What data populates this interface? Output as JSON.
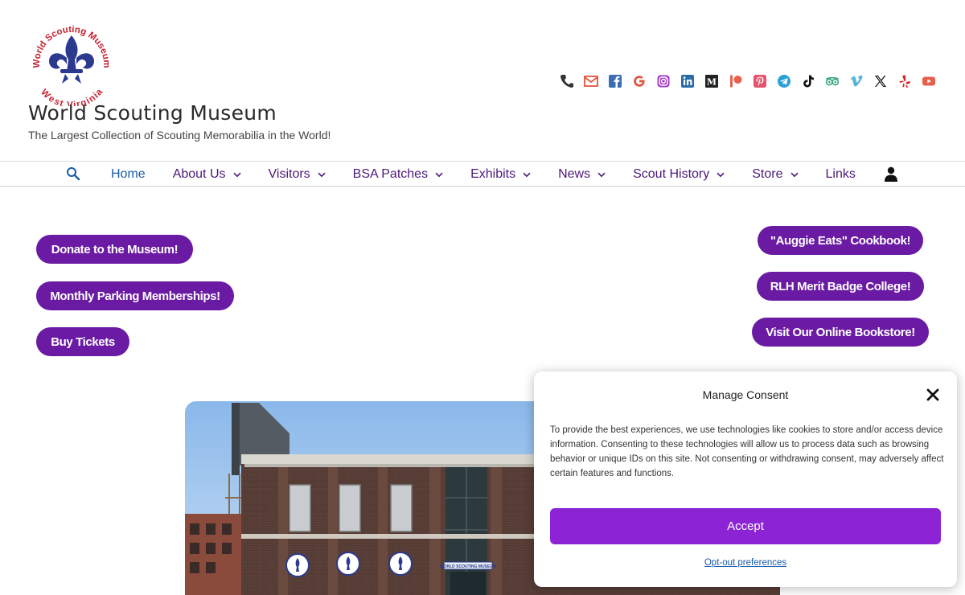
{
  "header": {
    "logo_text_top": "World Scouting Museum",
    "logo_text_bottom": "West Virginia",
    "site_title": "World Scouting Museum",
    "tagline": "The Largest Collection of Scouting Memorabilia in the World!"
  },
  "social_icons": [
    "phone-icon",
    "email-icon",
    "facebook-icon",
    "google-icon",
    "instagram-icon",
    "linkedin-icon",
    "medium-icon",
    "patreon-icon",
    "pinterest-icon",
    "telegram-icon",
    "tiktok-icon",
    "tripadvisor-icon",
    "vimeo-icon",
    "x-icon",
    "yelp-icon",
    "youtube-icon"
  ],
  "nav": {
    "items": [
      {
        "label": "Home",
        "dropdown": false
      },
      {
        "label": "About Us",
        "dropdown": true
      },
      {
        "label": "Visitors",
        "dropdown": true
      },
      {
        "label": "BSA Patches",
        "dropdown": true
      },
      {
        "label": "Exhibits",
        "dropdown": true
      },
      {
        "label": "News",
        "dropdown": true
      },
      {
        "label": "Scout History",
        "dropdown": true
      },
      {
        "label": "Store",
        "dropdown": true
      },
      {
        "label": "Links",
        "dropdown": false
      }
    ]
  },
  "buttons": {
    "donate": "Donate to the Museum!",
    "parking": "Monthly Parking Memberships!",
    "tickets": "Buy Tickets",
    "cookbook": "\"Auggie Eats\" Cookbook!",
    "merit": "RLH Merit Badge College!",
    "bookstore": "Visit Our Online Bookstore!"
  },
  "photo": {
    "sign_text": "WORLD SCOUTING MUSEUM"
  },
  "consent": {
    "title": "Manage Consent",
    "text": "To provide the best experiences, we use technologies like cookies to store and/or access device information. Consenting to these technologies will allow us to process data such as browsing behavior or unique IDs on this site. Not consenting or withdrawing consent, may adversely affect certain features and functions.",
    "accept": "Accept",
    "optout": "Opt-out preferences"
  },
  "colors": {
    "button_purple": "#6a1aa3",
    "accept_purple": "#8c24d6",
    "nav_text": "#4b1a7a",
    "logo_blue": "#2b3a8f",
    "logo_red": "#c8202f"
  }
}
